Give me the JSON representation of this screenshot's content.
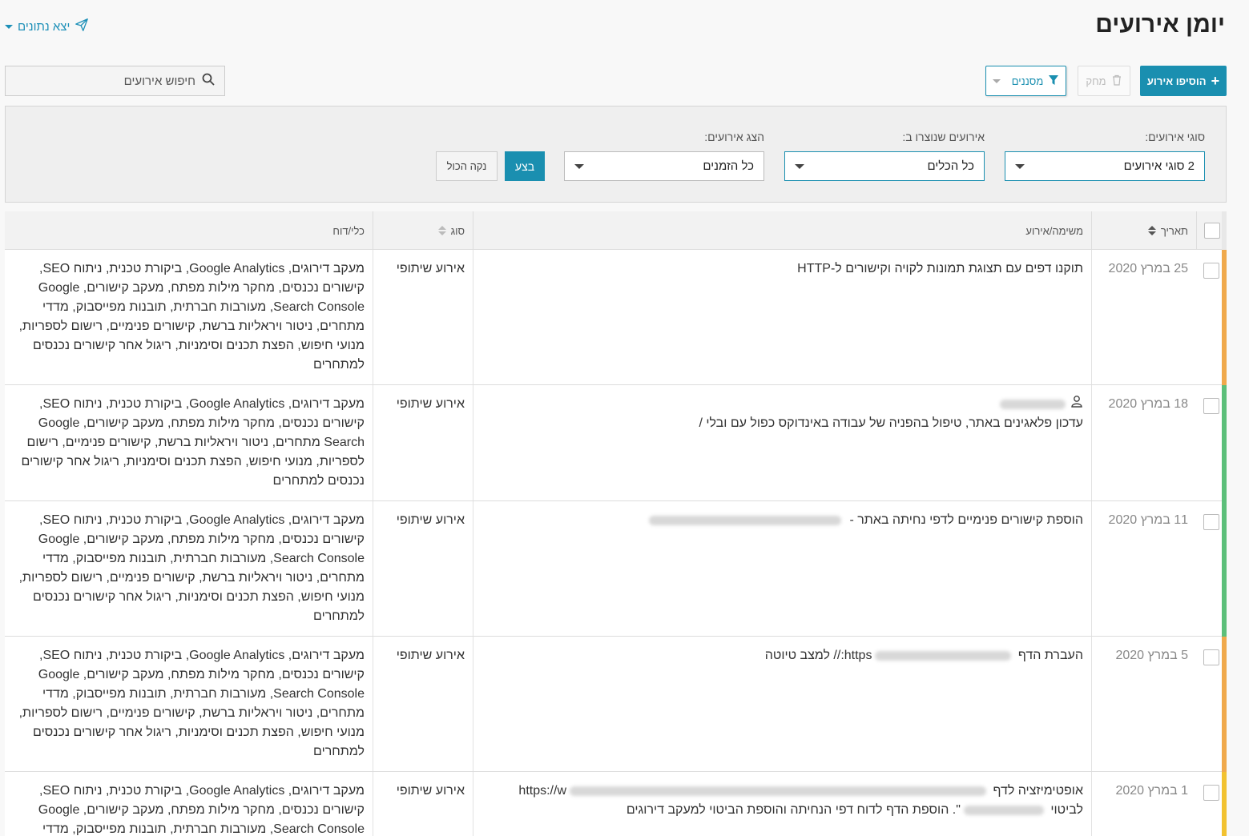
{
  "header": {
    "title": "יומן אירועים",
    "export_label": "יצא נתונים"
  },
  "toolbar": {
    "search_placeholder": "חיפוש אירועים",
    "add_label": "הוסיפו אירוע",
    "delete_label": "מחק",
    "filters_label": "מסננים"
  },
  "filters": {
    "event_types_label": "סוגי אירועים:",
    "event_types_value": "2 סוגי אירועים",
    "created_in_label": "אירועים שנוצרו ב:",
    "created_in_value": "כל הכלים",
    "show_label": "הצג אירועים:",
    "show_value": "כל הזמנים",
    "run_label": "בצע",
    "clear_label": "נקה הכול"
  },
  "table": {
    "columns": {
      "date": "תאריך",
      "task": "משימה/אירוע",
      "type": "סוג",
      "tools": "כלי/דוח"
    },
    "rows": [
      {
        "date": "25 במרץ 2020",
        "task": "תוקנו דפים עם תצוגת תמונות לקויה וקישורים ל-HTTP",
        "type": "אירוע שיתופי",
        "tools": "מעקב דירוגים, Google Analytics, ביקורת טכנית, ניתוח SEO, קישורים נכנסים, מחקר מילות מפתח, מעקב קישורים, Google Search Console, מעורבות חברתית, תובנות מפייסבוק, מדדי מתחרים, ניטור ויראליות ברשת, קישורים פנימיים, רישום לספריות, מנועי חיפוש, הפצת תכנים וסימניות, ריגול אחר קישורים נכנסים למתחרים",
        "bar_color": "#f0a94c"
      },
      {
        "date": "18 במרץ 2020",
        "task": "עדכון פלאגינים באתר, טיפול בהפניה של עבודה באינדוקס כפול עם ובלי /",
        "type": "אירוע שיתופי",
        "tools": "מעקב דירוגים, Google Analytics, ביקורת טכנית, ניתוח SEO, קישורים נכנסים, מחקר מילות מפתח, מעקב קישורים, Google Search מתחרים, ניטור ויראליות ברשת, קישורים פנימיים, רישום לספריות, מנועי חיפוש, הפצת תכנים וסימניות, ריגול אחר קישורים נכנסים למתחרים",
        "bar_color": "#5cbf7a"
      },
      {
        "date": "11 במרץ 2020",
        "task": "הוספת קישורים פנימיים לדפי נחיתה באתר -",
        "type": "אירוע שיתופי",
        "tools": "מעקב דירוגים, Google Analytics, ביקורת טכנית, ניתוח SEO, קישורים נכנסים, מחקר מילות מפתח, מעקב קישורים, Google Search Console, מעורבות חברתית, תובנות מפייסבוק, מדדי מתחרים, ניטור ויראליות ברשת, קישורים פנימיים, רישום לספריות, מנועי חיפוש, הפצת תכנים וסימניות, ריגול אחר קישורים נכנסים למתחרים",
        "bar_color": "#5cbf7a"
      },
      {
        "date": "5 במרץ 2020",
        "task_prefix": "העברת הדף",
        "task_suffix": "https://",
        "task_end": "למצב טיוטה",
        "type": "אירוע שיתופי",
        "tools": "מעקב דירוגים, Google Analytics, ביקורת טכנית, ניתוח SEO, קישורים נכנסים, מחקר מילות מפתח, מעקב קישורים, Google Search Console, מעורבות חברתית, תובנות מפייסבוק, מדדי מתחרים, ניטור ויראליות ברשת, קישורים פנימיים, רישום לספריות, מנועי חיפוש, הפצת תכנים וסימניות, ריגול אחר קישורים נכנסים למתחרים",
        "bar_color": "#f0a94c"
      },
      {
        "date": "1 במרץ 2020",
        "task_line1": "אופטימיזציה לדף",
        "task_url": "https://w",
        "task_line2_a": "לביטוי",
        "task_line2_b": "\". הוספת הדף לדוח דפי הנחיתה והוספת הביטוי למעקב דירוגים",
        "type": "אירוע שיתופי",
        "tools": "מעקב דירוגים, Google Analytics, ביקורת טכנית, ניתוח SEO, קישורים נכנסים, מחקר מילות מפתח, מעקב קישורים, Google Search Console, מעורבות חברתית, תובנות מפייסבוק, מדדי",
        "bar_color": "#f2c230"
      }
    ]
  }
}
